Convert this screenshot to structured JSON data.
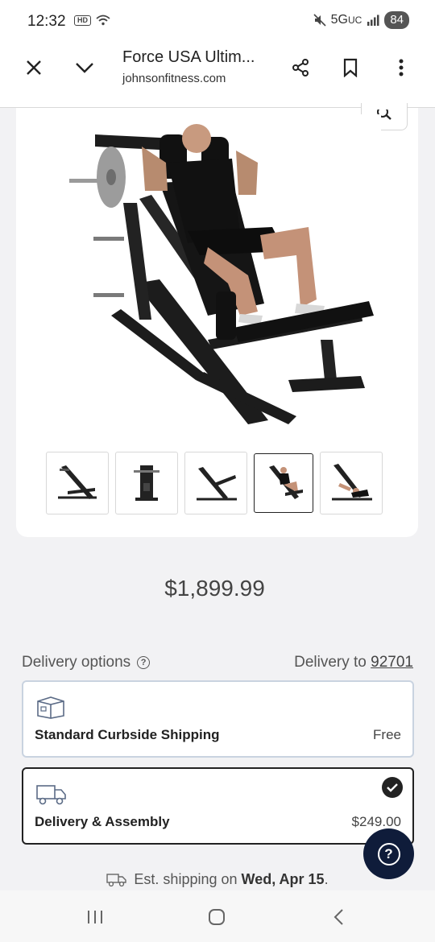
{
  "status_bar": {
    "time": "12:32",
    "hd_badge": "HD",
    "network": "5G",
    "network_suffix": "UC",
    "battery": "84"
  },
  "browser": {
    "title": "Force USA Ultim...",
    "domain": "johnsonfitness.com",
    "icons": [
      "close-icon",
      "chevron-down-icon",
      "share-icon",
      "bookmark-icon",
      "more-vert-icon"
    ]
  },
  "product": {
    "thumbnails": [
      {
        "name": "thumbnail-1",
        "active": false
      },
      {
        "name": "thumbnail-2",
        "active": false
      },
      {
        "name": "thumbnail-3",
        "active": false
      },
      {
        "name": "thumbnail-4",
        "active": true
      },
      {
        "name": "thumbnail-5",
        "active": false
      }
    ],
    "price": "$1,899.99"
  },
  "delivery": {
    "label": "Delivery options",
    "help_glyph": "?",
    "to_label": "Delivery to",
    "zip": "92701",
    "options": [
      {
        "name": "Standard Curbside Shipping",
        "price": "Free",
        "selected": false
      },
      {
        "name": "Delivery & Assembly",
        "price": "$249.00",
        "selected": true
      }
    ],
    "est_prefix": "Est. shipping on",
    "est_date": "Wed, Apr 15",
    "est_suffix": "."
  },
  "help_fab_glyph": "?",
  "colors": {
    "background": "#f2f2f4",
    "selected_border": "#222222",
    "unselected_border": "#c9d3e0",
    "fab": "#0f1c3a"
  }
}
